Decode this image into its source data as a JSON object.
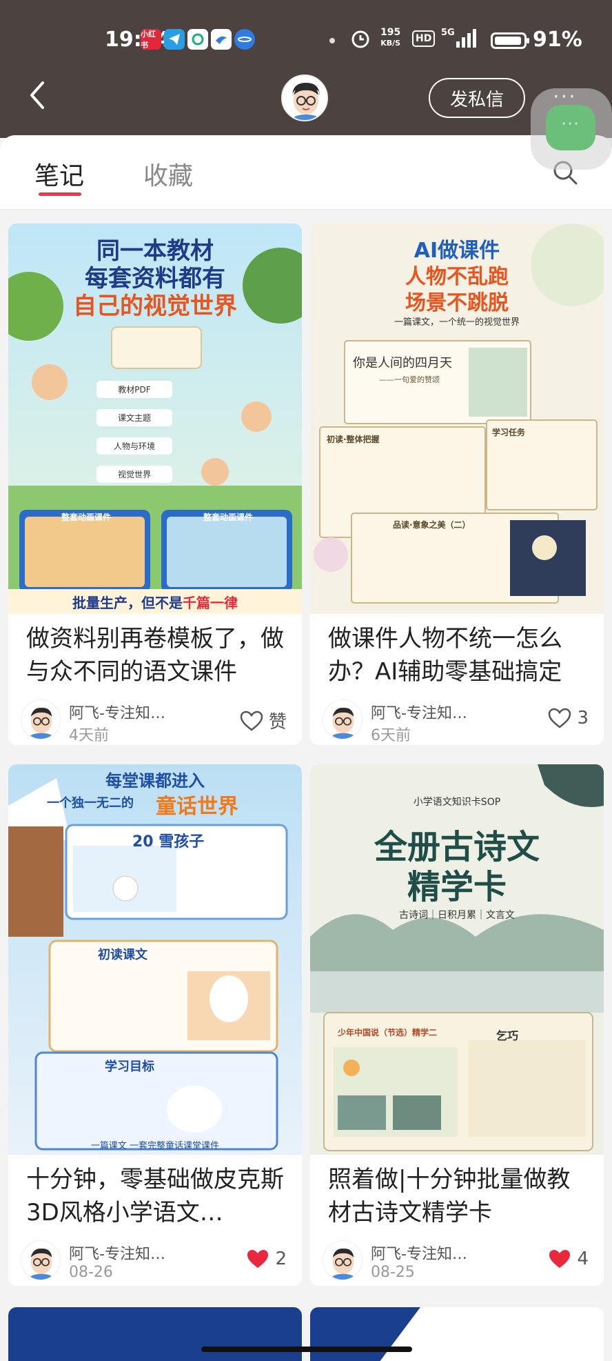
{
  "status_bar": {
    "time": "19:34",
    "speed_value": "195",
    "speed_unit": "KB/S",
    "hd_label": "HD",
    "network": "5G",
    "battery_pct": "91%",
    "battery_level": 0.91
  },
  "header": {
    "dm_label": "发私信",
    "more_label": "···",
    "float_label": "···"
  },
  "tabs": [
    {
      "label": "笔记",
      "active": true
    },
    {
      "label": "收藏",
      "active": false
    }
  ],
  "notes": [
    {
      "title": "做资料别再卷模板了，做与众不同的语文课件",
      "author": "阿飞-专注知…",
      "date": "4天前",
      "likes": "赞",
      "liked": false,
      "cover": {
        "lines": [
          "同一本教材",
          "每套资料都有",
          "自己的视觉世界"
        ],
        "steps": [
          "教材PDF",
          "课文主题",
          "人物与环境",
          "视觉世界"
        ],
        "tags": [
          "整套动画课件",
          "整套动画课件"
        ],
        "footer_prefix": "批量生产，但不是",
        "footer_accent": "千篇一律"
      }
    },
    {
      "title": "做课件人物不统一怎么办？AI辅助零基础搞定",
      "author": "阿飞-专注知…",
      "date": "6天前",
      "likes": "3",
      "liked": false,
      "cover": {
        "lines": [
          "AI做课件",
          "人物不乱跑",
          "场景不跳脱"
        ],
        "subtitle": "一篇课文，一个统一的视觉世界",
        "inner_title": "你是人间的四月天",
        "inner_sub": "——一句爱的赞颂",
        "section1": "初读·整体把握",
        "section2": "学习任务",
        "section3": "品读·意象之美（二）"
      }
    },
    {
      "title": "十分钟，零基础做皮克斯3D风格小学语文…",
      "author": "阿飞-专注知…",
      "date": "08-26",
      "likes": "2",
      "liked": true,
      "cover": {
        "lines": [
          "每堂课都进入",
          "一个独一无二的",
          "童话世界"
        ],
        "lesson": "20 雪孩子",
        "section1": "初读课文",
        "section2": "学习目标",
        "footer": "一篇课文 一套完整童话课堂课件"
      }
    },
    {
      "title": "照着做|十分钟批量做教材古诗文精学卡",
      "author": "阿飞-专注知…",
      "date": "08-25",
      "likes": "4",
      "liked": true,
      "cover": {
        "kicker": "小学语文知识卡SOP",
        "lines": [
          "全册古诗文",
          "精学卡"
        ],
        "subtitle": "古诗词｜日积月累｜文言文",
        "card_title": "少年中国说（节选）精学二",
        "card_right": "乞巧"
      }
    }
  ],
  "colors": {
    "header_bg": "#4c4240",
    "accent_red": "#e83a4a",
    "like_red": "#e8283c"
  }
}
